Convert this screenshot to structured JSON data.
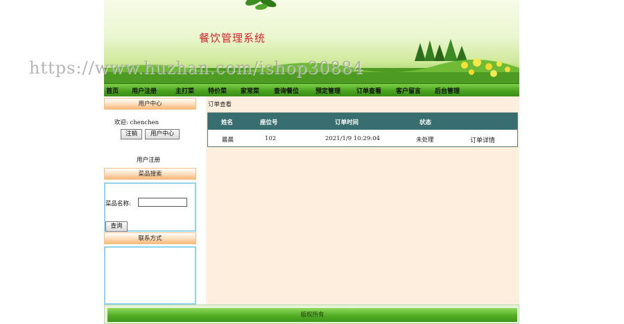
{
  "banner": {
    "title": "餐饮管理系统"
  },
  "watermark": "https://www.huzhan.com/ishop30884",
  "nav": [
    "首页",
    "用户注册",
    "主打菜",
    "特价菜",
    "家常菜",
    "查询餐位",
    "预定管理",
    "订单查看",
    "客户留言",
    "后台管理"
  ],
  "sidebar": {
    "user_center": {
      "heading": "用户中心",
      "welcome": "欢迎: chenchen",
      "logout_label": "注销",
      "user_center_label": "用户中心",
      "register_link": "用户注册"
    },
    "dish_search": {
      "heading": "菜品搜索",
      "field_label": "菜品名称:",
      "field_value": "",
      "query_label": "查询"
    },
    "contact": {
      "heading": "联系方式"
    }
  },
  "main": {
    "breadcrumb": "订单查看",
    "table": {
      "headers": [
        "姓名",
        "座位号",
        "订单时间",
        "状态"
      ],
      "rows": [
        {
          "name": "晨晨",
          "seat": "102",
          "time": "2021/1/9 10:29:04",
          "status": "未处理",
          "action": "订单详情"
        }
      ]
    }
  },
  "footer": {
    "text": "版权所有"
  },
  "colors": {
    "nav_green": "#4aa320",
    "table_header": "#386e6f",
    "main_bg": "#fdeedd",
    "sidebar_border": "#8fd3ee",
    "title_red": "#d2242c"
  }
}
